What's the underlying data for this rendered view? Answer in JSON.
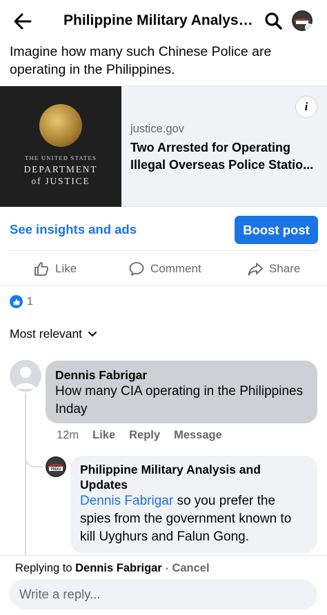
{
  "header": {
    "title": "Philippine Military Analysis..."
  },
  "post": {
    "text": "Imagine how many such Chinese Police are operating in the Philippines.",
    "link": {
      "image_lines": [
        "THE UNITED STATES",
        "DEPARTMENT",
        "of JUSTICE"
      ],
      "domain": "justice.gov",
      "headline_line1": "Two Arrested for Operating",
      "headline_line2": "Illegal Overseas Police Statio..."
    },
    "insights_label": "See insights and ads",
    "boost_label": "Boost post",
    "actions": {
      "like": "Like",
      "comment": "Comment",
      "share": "Share"
    },
    "reaction_count": "1",
    "sort_label": "Most relevant"
  },
  "comments": [
    {
      "author": "Dennis Fabrigar",
      "text": "How many CIA operating in the Philippines Inday",
      "time": "12m",
      "like": "Like",
      "reply": "Reply",
      "message": "Message"
    }
  ],
  "replies": [
    {
      "author": "Philippine Military Analysis and Updates",
      "mention": "Dennis Fabrigar",
      "text": " so you prefer the spies from the government known to kill Uyghurs and Falun Gong.",
      "avatar_text": "PMAU"
    }
  ],
  "reply_bar": {
    "prefix": "Replying to ",
    "name": "Dennis Fabrigar",
    "separator": " · ",
    "cancel": "Cancel",
    "placeholder": "Write a reply..."
  },
  "colors": {
    "accent": "#1b74e4",
    "secondary_text": "#65676b",
    "bubble_self": "#f0f2f5",
    "bubble_other": "#cdd0d4"
  }
}
